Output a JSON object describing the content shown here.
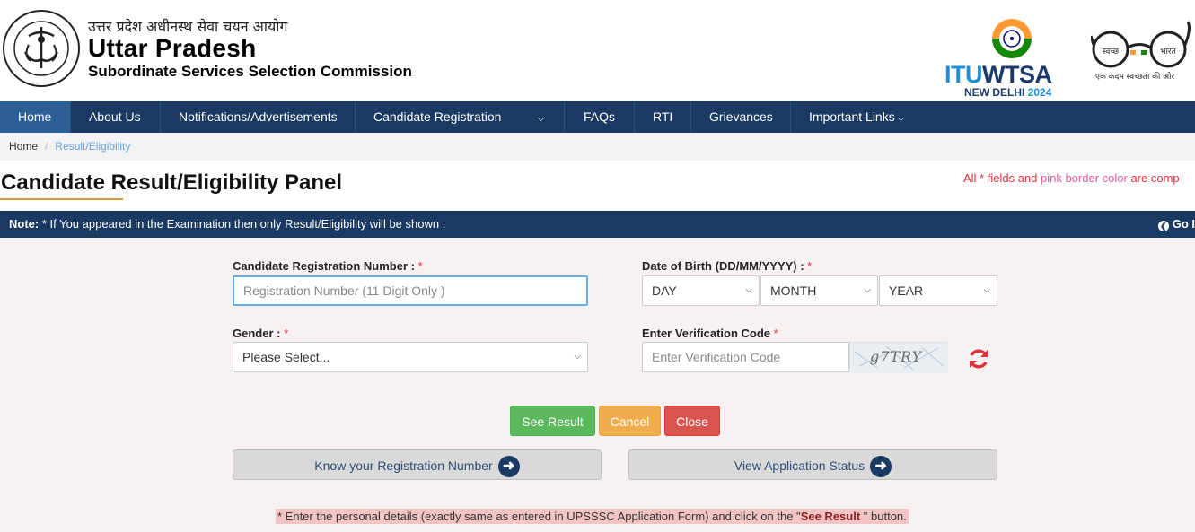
{
  "header": {
    "hindi_title": "उत्तर प्रदेश अधीनस्थ सेवा चयन आयोग",
    "title": "Uttar Pradesh",
    "subtitle": "Subordinate Services Selection Commission",
    "emblem_text": "उत्तर प्रदेश सरकार",
    "itu_part1": "ITU",
    "itu_part2": "WTSA",
    "itu_location": "NEW DELHI",
    "itu_year": "2024",
    "swachh_left": "स्वच्छ",
    "swachh_right": "भारत",
    "swachh_tagline": "एक कदम स्वच्छता की ओर"
  },
  "nav": {
    "items": [
      {
        "label": "Home"
      },
      {
        "label": "About Us"
      },
      {
        "label": "Notifications/Advertisements"
      },
      {
        "label": "Candidate Registration"
      },
      {
        "label": "FAQs"
      },
      {
        "label": "RTI"
      },
      {
        "label": "Grievances"
      },
      {
        "label": "Important Links"
      }
    ]
  },
  "breadcrumb": {
    "home": "Home",
    "separator": "/",
    "current": "Result/Eligibility"
  },
  "page": {
    "title": "Candidate Result/Eligibility Panel",
    "required_note_1": "All * fields and ",
    "required_note_pink": "pink border color",
    "required_note_2": " are comp"
  },
  "note": {
    "label": "Note:",
    "text": " * If You appeared in the Examination then only Result/Eligibility will be shown .",
    "go_back": "Go I"
  },
  "form": {
    "reg_label": "Candidate Registration Number : ",
    "reg_placeholder": "Registration Number (11 Digit Only )",
    "dob_label": "Date of Birth (DD/MM/YYYY) : ",
    "day": "DAY",
    "month": "MONTH",
    "year": "YEAR",
    "gender_label": "Gender : ",
    "gender_value": "Please Select...",
    "verif_label": "Enter Verification Code ",
    "verif_placeholder": "Enter Verification Code",
    "captcha": "g7TRY",
    "star": "*"
  },
  "buttons": {
    "see_result": "See Result",
    "cancel": "Cancel",
    "close": "Close",
    "know_reg": "Know your Registration Number",
    "view_status": "View Application Status"
  },
  "instruction": {
    "part1": "* Enter the personal details (exactly same as entered in UPSSSC Application Form) and click on the \"",
    "bold": "See Result",
    "part2": " \" button."
  },
  "colors": {
    "nav_bg": "#1a3a63",
    "nav_active": "#2c5f96",
    "accent_gold": "#d39a2f",
    "required_red": "#e0323c"
  }
}
